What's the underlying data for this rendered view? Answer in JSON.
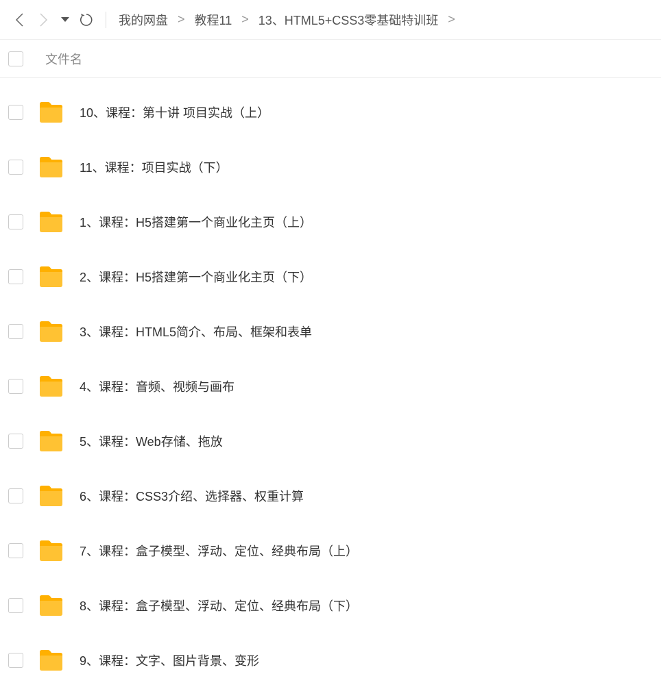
{
  "breadcrumb": {
    "items": [
      {
        "label": "我的网盘"
      },
      {
        "label": "教程11"
      },
      {
        "label": "13、HTML5+CSS3零基础特训班"
      }
    ],
    "separator": ">"
  },
  "header": {
    "filename_label": "文件名"
  },
  "files": [
    {
      "name": "10、课程：第十讲 项目实战（上）"
    },
    {
      "name": "11、课程：项目实战（下）"
    },
    {
      "name": "1、课程：H5搭建第一个商业化主页（上）"
    },
    {
      "name": "2、课程：H5搭建第一个商业化主页（下）"
    },
    {
      "name": "3、课程：HTML5简介、布局、框架和表单"
    },
    {
      "name": "4、课程：音频、视频与画布"
    },
    {
      "name": "5、课程：Web存储、拖放"
    },
    {
      "name": "6、课程：CSS3介绍、选择器、权重计算"
    },
    {
      "name": "7、课程：盒子模型、浮动、定位、经典布局（上）"
    },
    {
      "name": "8、课程：盒子模型、浮动、定位、经典布局（下）"
    },
    {
      "name": "9、课程：文字、图片背景、变形"
    }
  ],
  "colors": {
    "folder": "#FFC233"
  }
}
